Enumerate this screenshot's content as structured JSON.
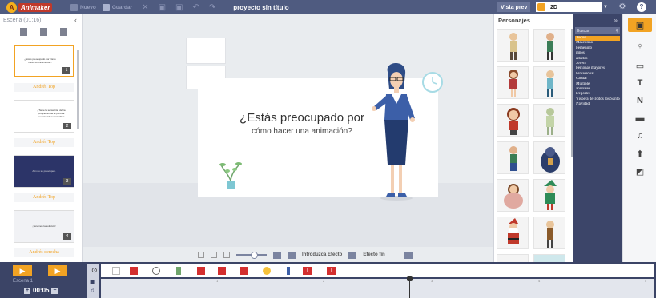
{
  "topbar": {
    "logo_text": "Animaker",
    "new_label": "Nuevo",
    "save_label": "Guardar",
    "project_title": "proyecto sin título",
    "preview_label": "Vista prev",
    "mode_value": "2D",
    "help_label": "?"
  },
  "left_panel": {
    "header": "Escena  (01:16)",
    "scenes": [
      {
        "label": "Andrés Top",
        "number": "1",
        "mini_text": "¿Estás preocupado por cómo hacer una animación?"
      },
      {
        "label": "Andrés Top",
        "number": "2",
        "mini_text": "¿Tiene la sensación de ha programa que le permita realizar videos increíbles"
      },
      {
        "label": "Andrés Top",
        "number": "3",
        "mini_text": "Aún no se preocupen."
      },
      {
        "label": "Andrés derecha",
        "number": "4",
        "mini_text": "¡Tenemos la solución!"
      }
    ]
  },
  "canvas": {
    "title": "¿Estás preocupado por",
    "subtitle": "cómo hacer una animación?",
    "toolbar": {
      "enter_effect": "Introduzca Efecto",
      "exit_effect": "Efecto fin"
    }
  },
  "characters_panel": {
    "header": "Personajes",
    "collapse": "»",
    "search_placeholder": "Buscar",
    "filters": [
      "Todos",
      "Masculino",
      "Femenino",
      "niños",
      "adultos",
      "Joven",
      "Personas mayores",
      "Profesional",
      "Casual",
      "Múltiple",
      "animales",
      "Deportes",
      "Víspera de Todos los Santos",
      "Navidad"
    ],
    "selected_filter": "Todos"
  },
  "timeline": {
    "scene_name": "Escena 1",
    "time": "00:05",
    "ticks": [
      "1",
      "2",
      "3",
      "4",
      "5"
    ]
  },
  "colors": {
    "accent": "#f2a323",
    "topbar": "#4f5b80",
    "timeline": "#3b4466",
    "filter_bg": "#3c4569"
  }
}
